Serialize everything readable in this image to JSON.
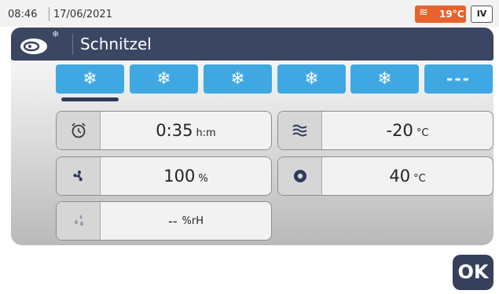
{
  "status": {
    "time": "08:46",
    "date": "17/06/2021",
    "oven_temp": "19°C",
    "level": "IV"
  },
  "recipe": {
    "title": "Schnitzel"
  },
  "phases": [
    {
      "icon": "snowflake-icon",
      "label": "❄"
    },
    {
      "icon": "snowflake-icon",
      "label": "❄"
    },
    {
      "icon": "snowflake-icon",
      "label": "❄"
    },
    {
      "icon": "snowflake-icon",
      "label": "❄"
    },
    {
      "icon": "snowflake-icon",
      "label": "❄"
    },
    {
      "icon": "empty-phase",
      "label": "---"
    }
  ],
  "params": {
    "time": {
      "icon": "alarm-clock-icon",
      "value": "0:35",
      "unit": "h:m"
    },
    "fan": {
      "icon": "fan-icon",
      "value": "100",
      "unit": "%"
    },
    "humidity": {
      "icon": "water-drops-icon",
      "value": "--",
      "unit": "%rH"
    },
    "chamber_temp": {
      "icon": "wavy-heat-icon",
      "value": "-20",
      "unit": "°C"
    },
    "core_temp": {
      "icon": "core-probe-icon",
      "value": "40",
      "unit": "°C"
    }
  },
  "ok_label": "OK",
  "colors": {
    "accent_blue": "#3fa8e3",
    "header_navy": "#3b4663",
    "alert_orange": "#e8622e"
  }
}
